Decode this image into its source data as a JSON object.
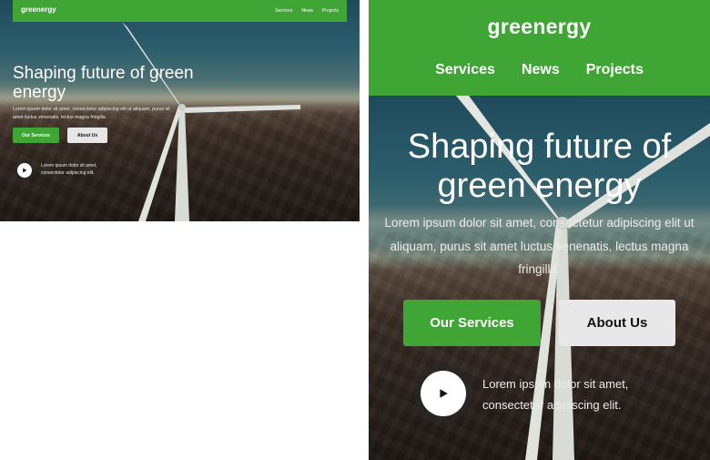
{
  "brand": {
    "name": "greenergy",
    "accent": "#3fa535"
  },
  "nav": {
    "items": [
      {
        "label": "Services"
      },
      {
        "label": "News"
      },
      {
        "label": "Projects"
      }
    ]
  },
  "hero": {
    "title": "Shaping future of green energy",
    "subtitle": "Lorem ipsum dolor sit amet, consectetur adipiscing elit ut aliquam, purus sit amet luctus venenatis, lectus magna fringilla.",
    "primary_button": "Our Services",
    "secondary_button": "About Us",
    "video_caption": "Lorem ipsum dolor sit amet, consectetur adipiscing elit.",
    "play_icon": "play-icon"
  }
}
